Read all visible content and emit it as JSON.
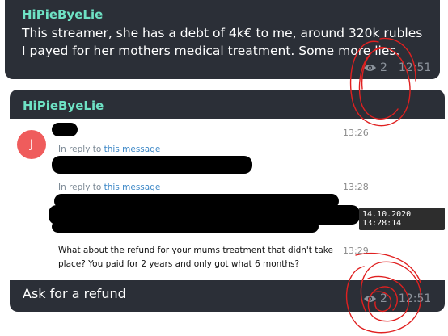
{
  "messages": [
    {
      "sender": "HiPieByeLie",
      "lines": [
        "This streamer, she has a debt of 4k€ to me, around 320k rubles",
        "I payed for her mothers medical treatment. Some more lies."
      ],
      "views": "2",
      "time": "12:51"
    },
    {
      "sender": "HiPieByeLie",
      "caption": "Ask for a refund",
      "views": "2",
      "time": "12:51",
      "embedded_screenshot": {
        "avatar_letter": "J",
        "times": [
          "13:26",
          "13:28",
          "13:29"
        ],
        "reply_prefix": "In reply to",
        "reply_link": "this message",
        "tooltip": "14.10.2020 13:28:14",
        "question_lines": [
          "What about the refund for your mums treatment that didn't take",
          "place? You paid for 2 years and only got what 6 months?"
        ]
      }
    }
  ],
  "colors": {
    "bubble": "#2b2f37",
    "sender": "#6ee2c4",
    "meta": "#8c939c",
    "scribble": "#e02020",
    "avatar": "#ef5c5c",
    "link": "#3a86c6"
  }
}
